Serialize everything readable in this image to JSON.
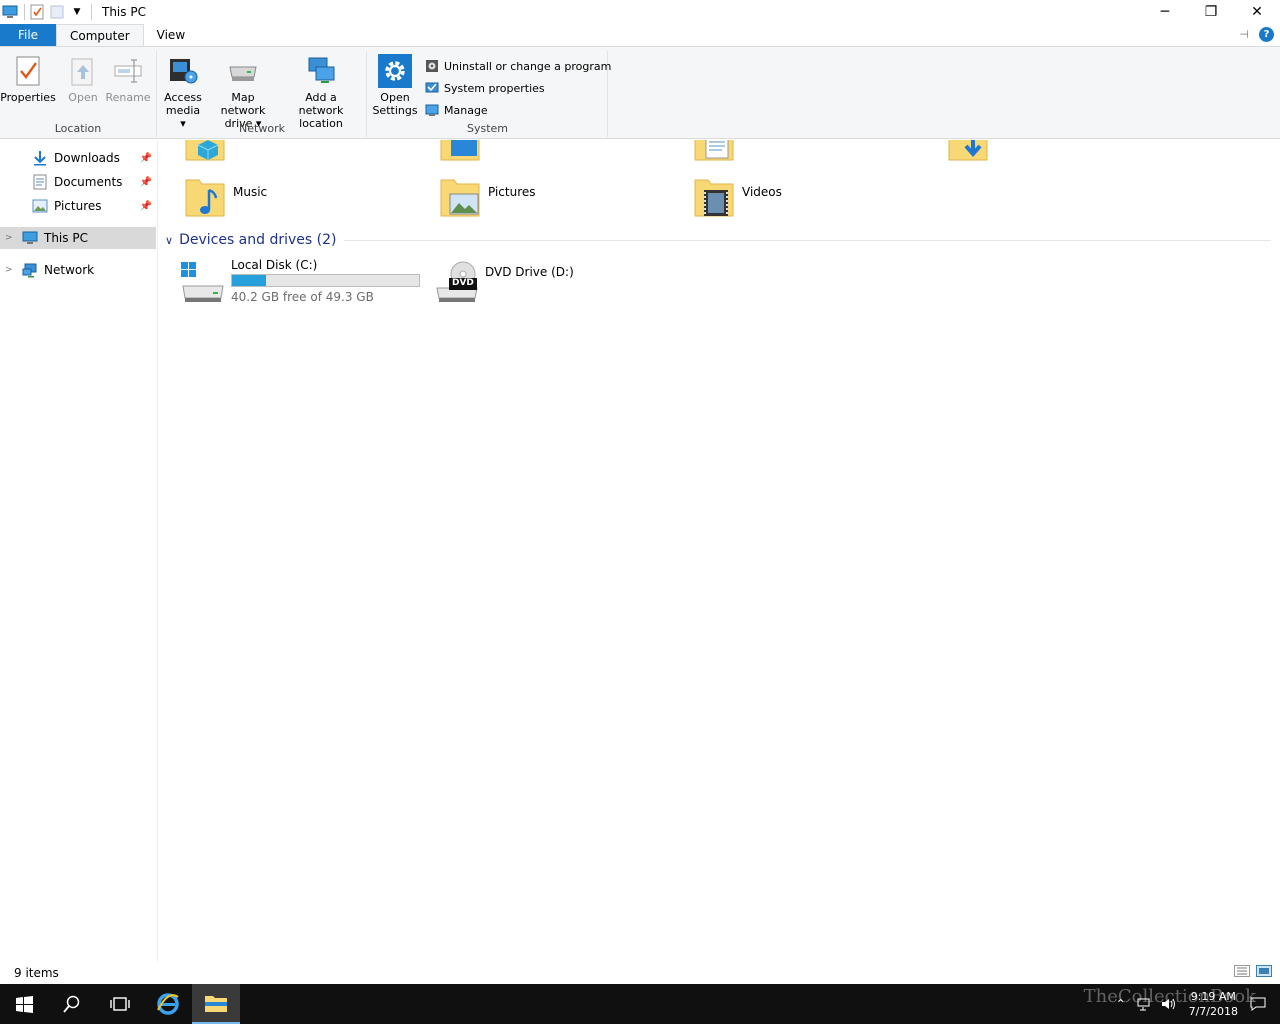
{
  "window": {
    "title": "This PC",
    "minimize": "─",
    "restore": "❐",
    "close": "✕"
  },
  "ribbon": {
    "tabs": [
      {
        "label": "File"
      },
      {
        "label": "Computer"
      },
      {
        "label": "View"
      }
    ],
    "help": "?",
    "groups": {
      "location": {
        "label": "Location",
        "properties": "Properties",
        "open": "Open",
        "rename": "Rename"
      },
      "network": {
        "label": "Network",
        "access_media_l1": "Access",
        "access_media_l2": "media ▾",
        "map_drive_l1": "Map network",
        "map_drive_l2": "drive ▾",
        "add_location_l1": "Add a network",
        "add_location_l2": "location"
      },
      "system": {
        "label": "System",
        "open_settings_l1": "Open",
        "open_settings_l2": "Settings",
        "uninstall": "Uninstall or change a program",
        "system_properties": "System properties",
        "manage": "Manage"
      }
    }
  },
  "nav": {
    "items": [
      {
        "label": "Downloads"
      },
      {
        "label": "Documents"
      },
      {
        "label": "Pictures"
      },
      {
        "label": "This PC"
      },
      {
        "label": "Network"
      }
    ]
  },
  "content": {
    "folders": [
      {
        "name": "Music"
      },
      {
        "name": "Pictures"
      },
      {
        "name": "Videos"
      }
    ],
    "devices_section": "Devices and drives (2)",
    "drives": [
      {
        "name": "Local Disk (C:)",
        "free": "40.2 GB free of 49.3 GB",
        "used_fraction": 0.18
      },
      {
        "name": "DVD Drive (D:)",
        "badge": "DVD"
      }
    ]
  },
  "status": {
    "items": "9 items"
  },
  "taskbar": {
    "time": "9:19 AM",
    "date": "7/7/2018",
    "watermark": "TheCollectionBook"
  },
  "colors": {
    "accent": "#1979ca",
    "section_title": "#1e3287",
    "drive_bar": "#26a0da",
    "folder": "#f8d775"
  }
}
